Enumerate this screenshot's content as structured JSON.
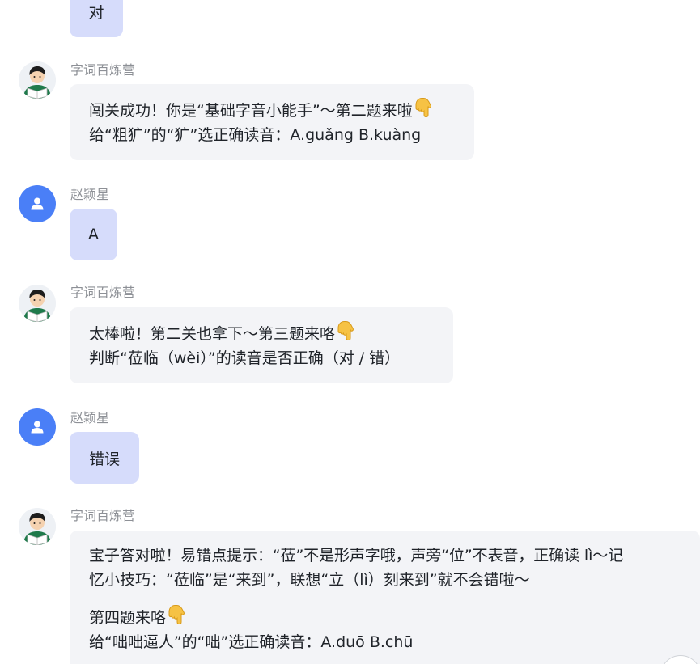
{
  "messages": {
    "m0": {
      "text": "对"
    },
    "m1": {
      "sender": "字词百炼营",
      "line1": "闯关成功！你是“基础字音小能手”～第二题来啦",
      "line2": "给“粗犷”的“犷”选正确读音：A.guǎng B.kuàng"
    },
    "m2": {
      "sender": "赵颖星",
      "text": "A"
    },
    "m3": {
      "sender": "字词百炼营",
      "line1": "太棒啦！第二关也拿下～第三题来咯",
      "line2": "判断“莅临（wèi）”的读音是否正确（对 / 错）"
    },
    "m4": {
      "sender": "赵颖星",
      "text": "错误"
    },
    "m5": {
      "sender": "字词百炼营",
      "line1": "宝子答对啦！易错点提示：“莅”不是形声字哦，声旁“位”不表音，正确读 lì～记",
      "line2": "忆小技巧：“莅临”是“来到”，联想“立（lì）刻来到”就不会错啦～",
      "line3": "第四题来咯",
      "line4": "给“咄咄逼人”的“咄”选正确读音：A.duō B.chū"
    }
  },
  "icons": {
    "bot_avatar": "boy-reading-avatar-icon",
    "user_avatar": "person-icon",
    "hand": "backhand-index-pointing-down-emoji"
  },
  "colors": {
    "user_bubble": "#d6dcfb",
    "bot_bubble": "#f3f4f7",
    "user_avatar": "#4a7ff7",
    "sender_name": "#8d9096",
    "text": "#1f2329"
  }
}
